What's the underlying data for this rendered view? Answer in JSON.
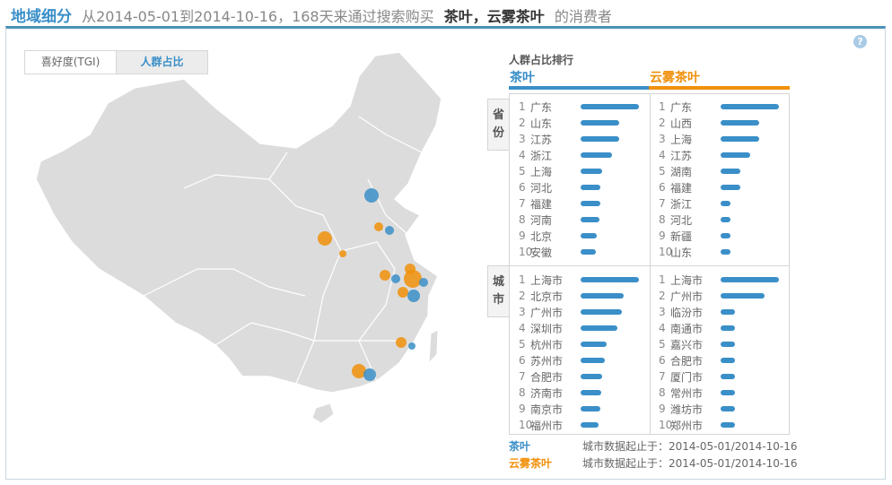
{
  "header": {
    "title": "地域细分",
    "desc": "从2014-05-01到2014-10-16，168天来通过搜索购买",
    "keywords": "茶叶，云雾茶叶",
    "suffix": "的消费者"
  },
  "help_icon": "?",
  "tabs": [
    {
      "label": "喜好度(TGI)",
      "active": false
    },
    {
      "label": "人群占比",
      "active": true
    }
  ],
  "colors": {
    "series1": "#3a8fc8",
    "series2": "#f0900a"
  },
  "map": {
    "bubbles": [
      {
        "series": "茶叶",
        "region": "北京",
        "size": 8
      },
      {
        "series": "茶叶",
        "region": "山东",
        "size": 5
      },
      {
        "series": "云雾茶叶",
        "region": "山东",
        "size": 5
      },
      {
        "series": "云雾茶叶",
        "region": "山西",
        "size": 8
      },
      {
        "series": "云雾茶叶",
        "region": "河南",
        "size": 4
      },
      {
        "series": "云雾茶叶",
        "region": "安徽",
        "size": 6
      },
      {
        "series": "茶叶",
        "region": "安徽",
        "size": 5
      },
      {
        "series": "云雾茶叶",
        "region": "江苏",
        "size": 6
      },
      {
        "series": "云雾茶叶",
        "region": "上海",
        "size": 10
      },
      {
        "series": "茶叶",
        "region": "上海",
        "size": 5
      },
      {
        "series": "云雾茶叶",
        "region": "浙江",
        "size": 6
      },
      {
        "series": "茶叶",
        "region": "浙江",
        "size": 7
      },
      {
        "series": "茶叶",
        "region": "福建",
        "size": 4
      },
      {
        "series": "云雾茶叶",
        "region": "福建",
        "size": 6
      },
      {
        "series": "云雾茶叶",
        "region": "广东",
        "size": 8
      },
      {
        "series": "茶叶",
        "region": "广东",
        "size": 7
      }
    ]
  },
  "ranking": {
    "title": "人群占比排行",
    "series": [
      "茶叶",
      "云雾茶叶"
    ],
    "province_label": "省份",
    "city_label": "城市",
    "provinces": [
      [
        {
          "name": "广东",
          "v": 100
        },
        {
          "name": "山东",
          "v": 66
        },
        {
          "name": "江苏",
          "v": 66
        },
        {
          "name": "浙江",
          "v": 54
        },
        {
          "name": "上海",
          "v": 37
        },
        {
          "name": "河北",
          "v": 34
        },
        {
          "name": "福建",
          "v": 34
        },
        {
          "name": "河南",
          "v": 32
        },
        {
          "name": "北京",
          "v": 28
        },
        {
          "name": "安徽",
          "v": 26
        }
      ],
      [
        {
          "name": "广东",
          "v": 100
        },
        {
          "name": "山西",
          "v": 66
        },
        {
          "name": "上海",
          "v": 66
        },
        {
          "name": "江苏",
          "v": 51
        },
        {
          "name": "湖南",
          "v": 34
        },
        {
          "name": "福建",
          "v": 34
        },
        {
          "name": "浙江",
          "v": 17
        },
        {
          "name": "河北",
          "v": 17
        },
        {
          "name": "新疆",
          "v": 17
        },
        {
          "name": "山东",
          "v": 17
        }
      ]
    ],
    "cities": [
      [
        {
          "name": "上海市",
          "v": 100
        },
        {
          "name": "北京市",
          "v": 74
        },
        {
          "name": "广州市",
          "v": 71
        },
        {
          "name": "深圳市",
          "v": 63
        },
        {
          "name": "杭州市",
          "v": 45
        },
        {
          "name": "苏州市",
          "v": 42
        },
        {
          "name": "合肥市",
          "v": 37
        },
        {
          "name": "济南市",
          "v": 35
        },
        {
          "name": "南京市",
          "v": 34
        },
        {
          "name": "福州市",
          "v": 31
        }
      ],
      [
        {
          "name": "上海市",
          "v": 100
        },
        {
          "name": "广州市",
          "v": 75
        },
        {
          "name": "临汾市",
          "v": 25
        },
        {
          "name": "南通市",
          "v": 25
        },
        {
          "name": "嘉兴市",
          "v": 25
        },
        {
          "name": "合肥市",
          "v": 25
        },
        {
          "name": "厦门市",
          "v": 25
        },
        {
          "name": "常州市",
          "v": 25
        },
        {
          "name": "潍坊市",
          "v": 25
        },
        {
          "name": "郑州市",
          "v": 25
        }
      ]
    ]
  },
  "footer": [
    {
      "series": "茶叶",
      "text": "城市数据起止于：2014-05-01/2014-10-16"
    },
    {
      "series": "云雾茶叶",
      "text": "城市数据起止于：2014-05-01/2014-10-16"
    }
  ]
}
